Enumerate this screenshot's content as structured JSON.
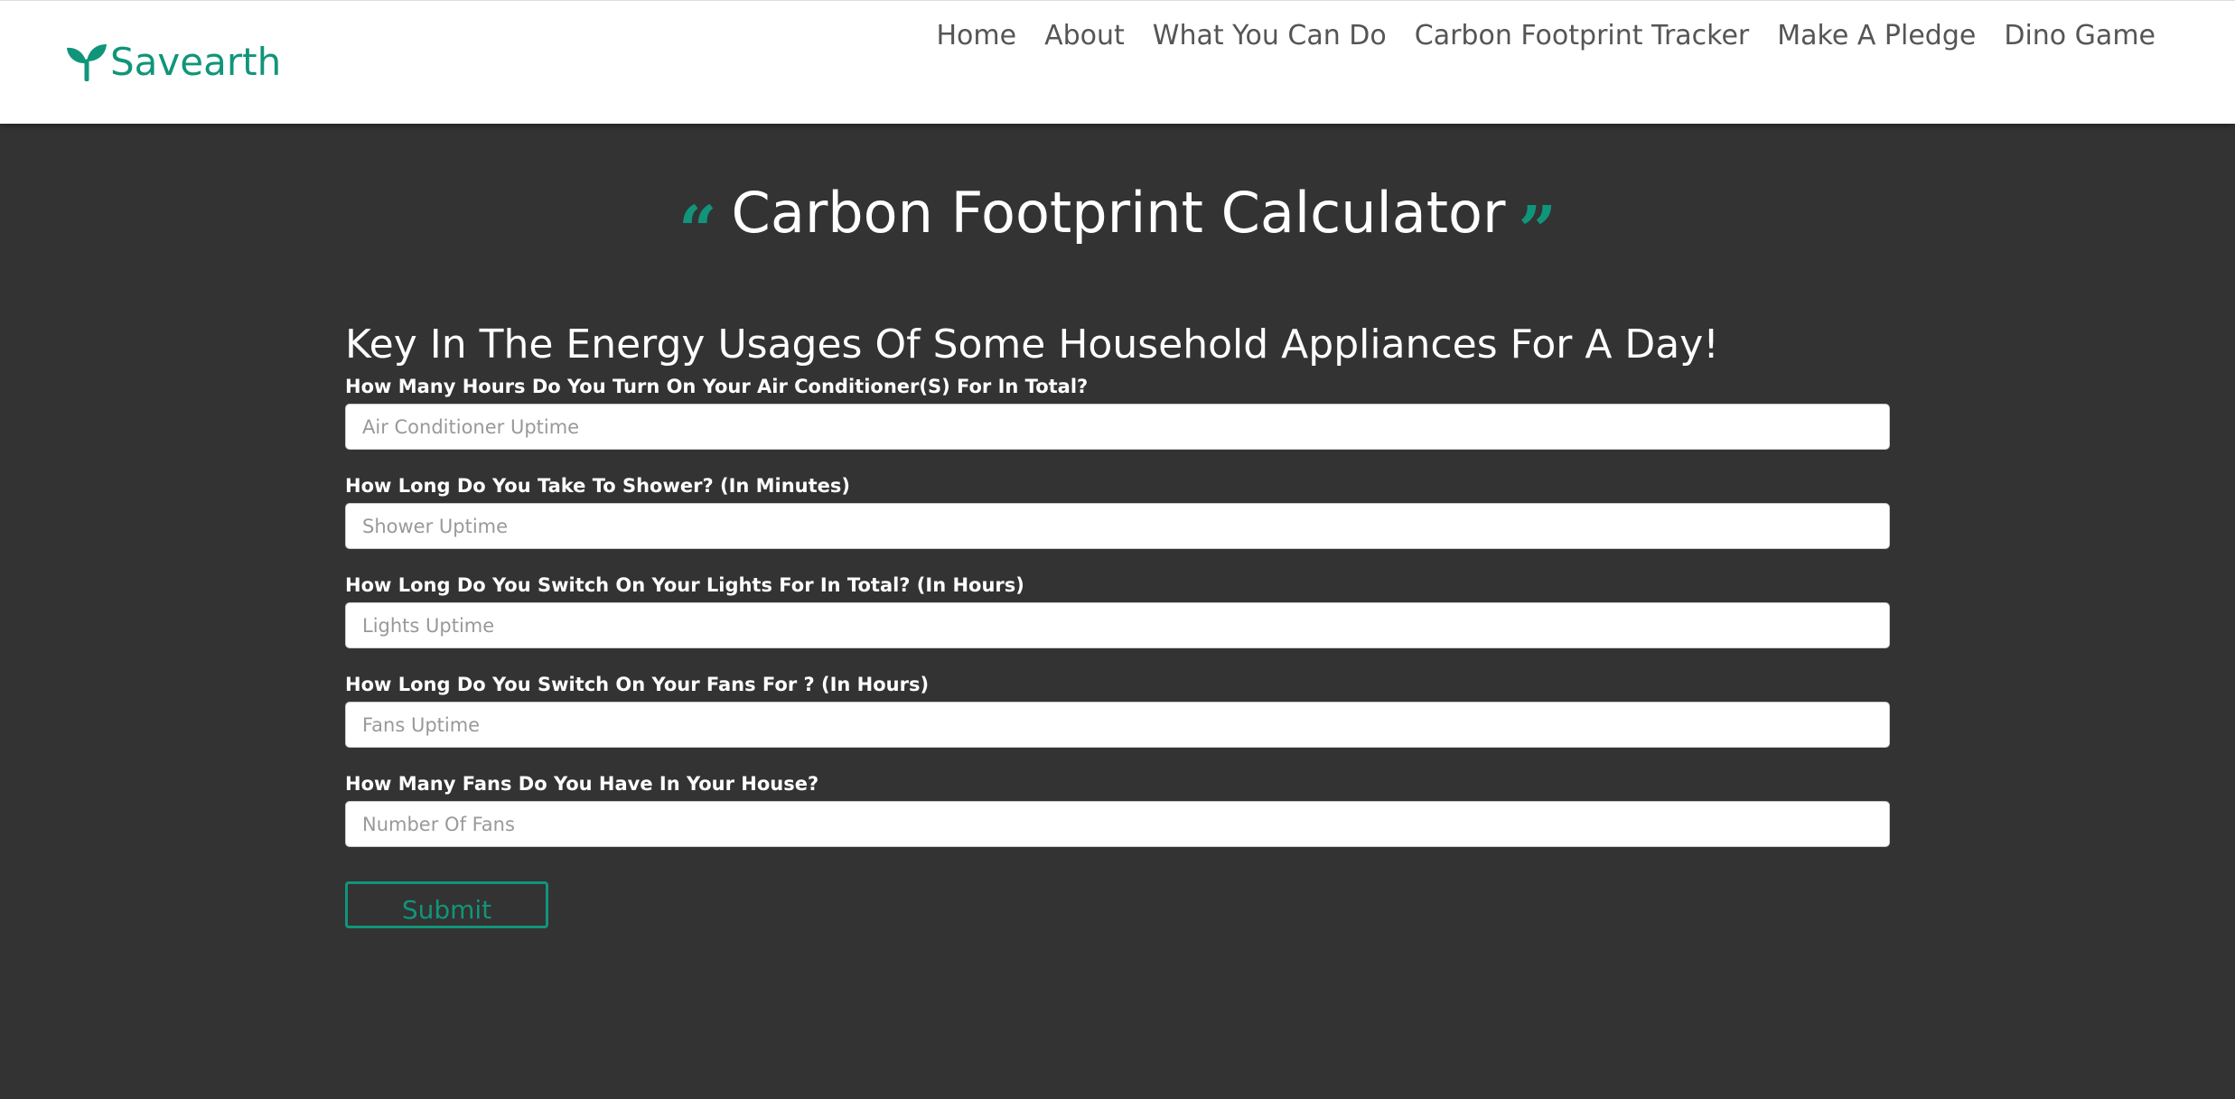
{
  "brand": {
    "name": "Savearth",
    "icon": "sprout-icon",
    "color": "#10957a"
  },
  "nav": {
    "items": [
      {
        "label": "Home"
      },
      {
        "label": "About"
      },
      {
        "label": "What You Can Do"
      },
      {
        "label": "Carbon Footprint Tracker"
      },
      {
        "label": "Make A Pledge"
      },
      {
        "label": "Dino Game"
      }
    ]
  },
  "hero": {
    "title": "Carbon Footprint Calculator",
    "quote_open": "“",
    "quote_close": "”"
  },
  "form": {
    "heading": "Key In The Energy Usages Of Some Household Appliances For A Day!",
    "fields": [
      {
        "label": "How Many Hours Do You Turn On Your Air Conditioner(S) For In Total?",
        "placeholder": "Air Conditioner Uptime",
        "value": ""
      },
      {
        "label": "How Long Do You Take To Shower? (In Minutes)",
        "placeholder": "Shower Uptime",
        "value": ""
      },
      {
        "label": "How Long Do You Switch On Your Lights For In Total? (In Hours)",
        "placeholder": "Lights Uptime",
        "value": ""
      },
      {
        "label": "How Long Do You Switch On Your Fans For ? (In Hours)",
        "placeholder": "Fans Uptime",
        "value": ""
      },
      {
        "label": "How Many Fans Do You Have In Your House?",
        "placeholder": "Number Of Fans",
        "value": ""
      }
    ],
    "submit_label": "Submit"
  },
  "colors": {
    "accent": "#10957a",
    "background": "#333333",
    "navbar": "#ffffff",
    "nav_text": "#555555"
  }
}
